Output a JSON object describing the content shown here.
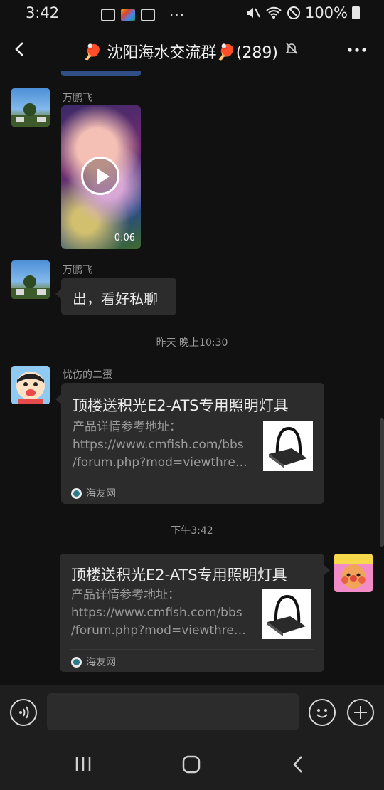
{
  "status_bar": {
    "time": "3:42",
    "battery": "100%"
  },
  "header": {
    "title": "🏓 沈阳海水交流群🏓(289)"
  },
  "messages": [
    {
      "sender": "万鹏飞",
      "type": "video",
      "duration": "0:06"
    },
    {
      "sender": "万鹏飞",
      "type": "text",
      "text": "出，看好私聊"
    },
    {
      "type": "time",
      "text": "昨天 晚上10:30"
    },
    {
      "sender": "忧伤的二蛋",
      "type": "link",
      "title": "顶楼送积光E2-ATS专用照明灯具",
      "desc_line1": "产品详情参考地址：",
      "desc_line2": "https://www.cmfish.com/bbs",
      "desc_line3": "/forum.php?mod=viewthread&tid",
      "source": "海友网"
    },
    {
      "type": "time",
      "text": "下午3:42"
    },
    {
      "sender": "",
      "type": "link",
      "title": "顶楼送积光E2-ATS专用照明灯具",
      "desc_line1": "产品详情参考地址：",
      "desc_line2": "https://www.cmfish.com/bbs",
      "desc_line3": "/forum.php?mod=viewthread&tid",
      "source": "海友网"
    }
  ],
  "input": {
    "value": "",
    "placeholder": ""
  },
  "icons": {
    "back": "back-arrow-icon",
    "mute": "bell-off-icon",
    "more": "more-dots-icon",
    "voice": "voice-icon",
    "emoji": "emoji-icon",
    "add": "plus-icon"
  },
  "colors": {
    "background": "#111111",
    "bubble": "#2c2c2c",
    "bar": "#1e1e1e",
    "muted_text": "#9a9a9a"
  }
}
